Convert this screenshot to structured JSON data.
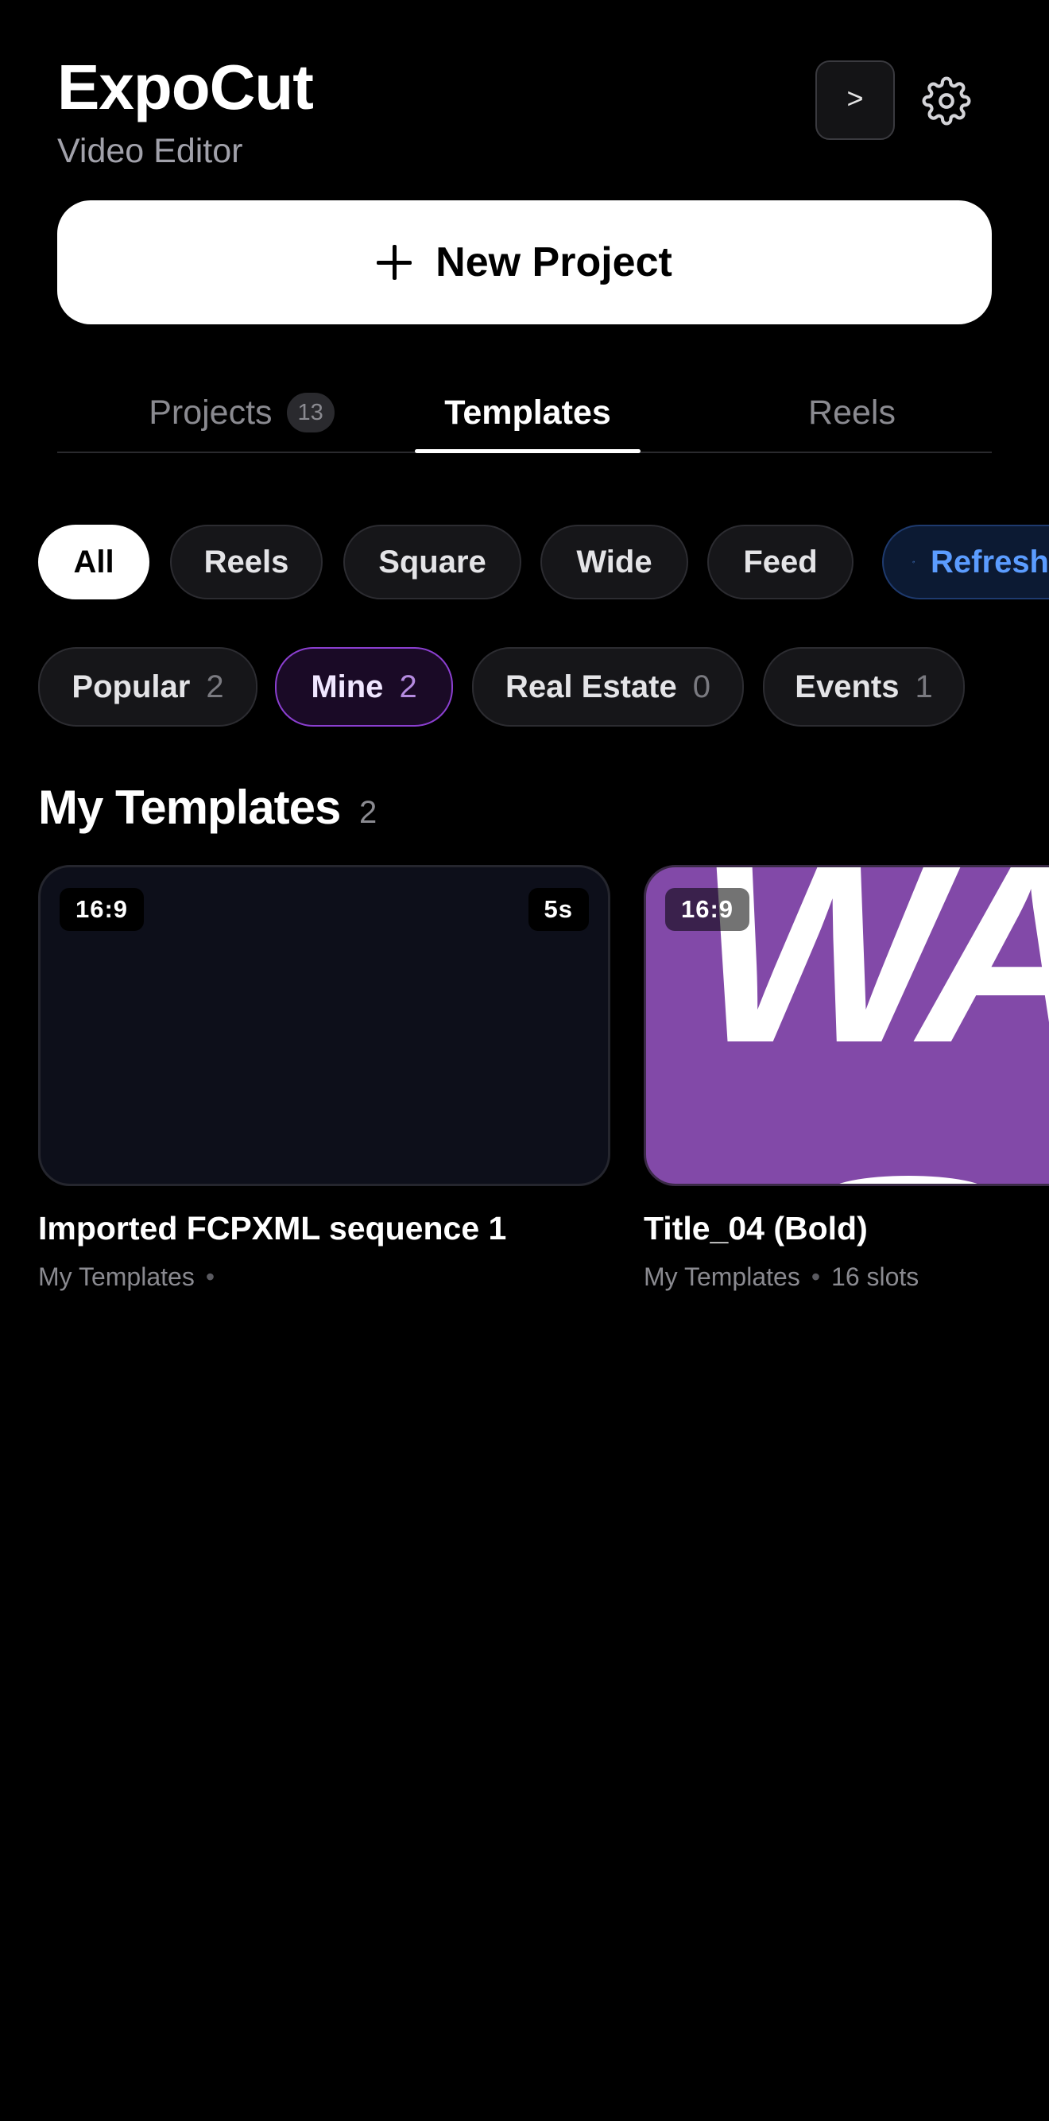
{
  "header": {
    "title": "ExpoCut",
    "subtitle": "Video Editor",
    "terminal_label": ">",
    "settings_icon": "gear-icon"
  },
  "new_project": {
    "label": "New Project",
    "icon": "plus-icon"
  },
  "tabs": [
    {
      "label": "Projects",
      "badge": "13",
      "active": false
    },
    {
      "label": "Templates",
      "active": true
    },
    {
      "label": "Reels",
      "active": false
    }
  ],
  "format_filters": [
    {
      "label": "All",
      "active": true
    },
    {
      "label": "Reels"
    },
    {
      "label": "Square"
    },
    {
      "label": "Wide"
    },
    {
      "label": "Feed"
    },
    {
      "label": "Refresh",
      "icon": "refresh-icon"
    }
  ],
  "category_filters": [
    {
      "label": "Popular",
      "count": "2"
    },
    {
      "label": "Mine",
      "count": "2",
      "active": true
    },
    {
      "label": "Real Estate",
      "count": "0"
    },
    {
      "label": "Events",
      "count": "1"
    }
  ],
  "section": {
    "title": "My Templates",
    "count": "2"
  },
  "templates": [
    {
      "title": "Imported FCPXML sequence 1",
      "aspect": "16:9",
      "duration": "5s",
      "category": "My Templates",
      "separator": "•",
      "slots": ""
    },
    {
      "title": "Title_04 (Bold)",
      "aspect": "16:9",
      "thumb_text": "WA",
      "category": "My Templates",
      "separator": "•",
      "slots": "16 slots"
    }
  ],
  "colors": {
    "background": "#000000",
    "accent_purple": "#8249a8",
    "refresh_blue": "#5b9cff"
  }
}
